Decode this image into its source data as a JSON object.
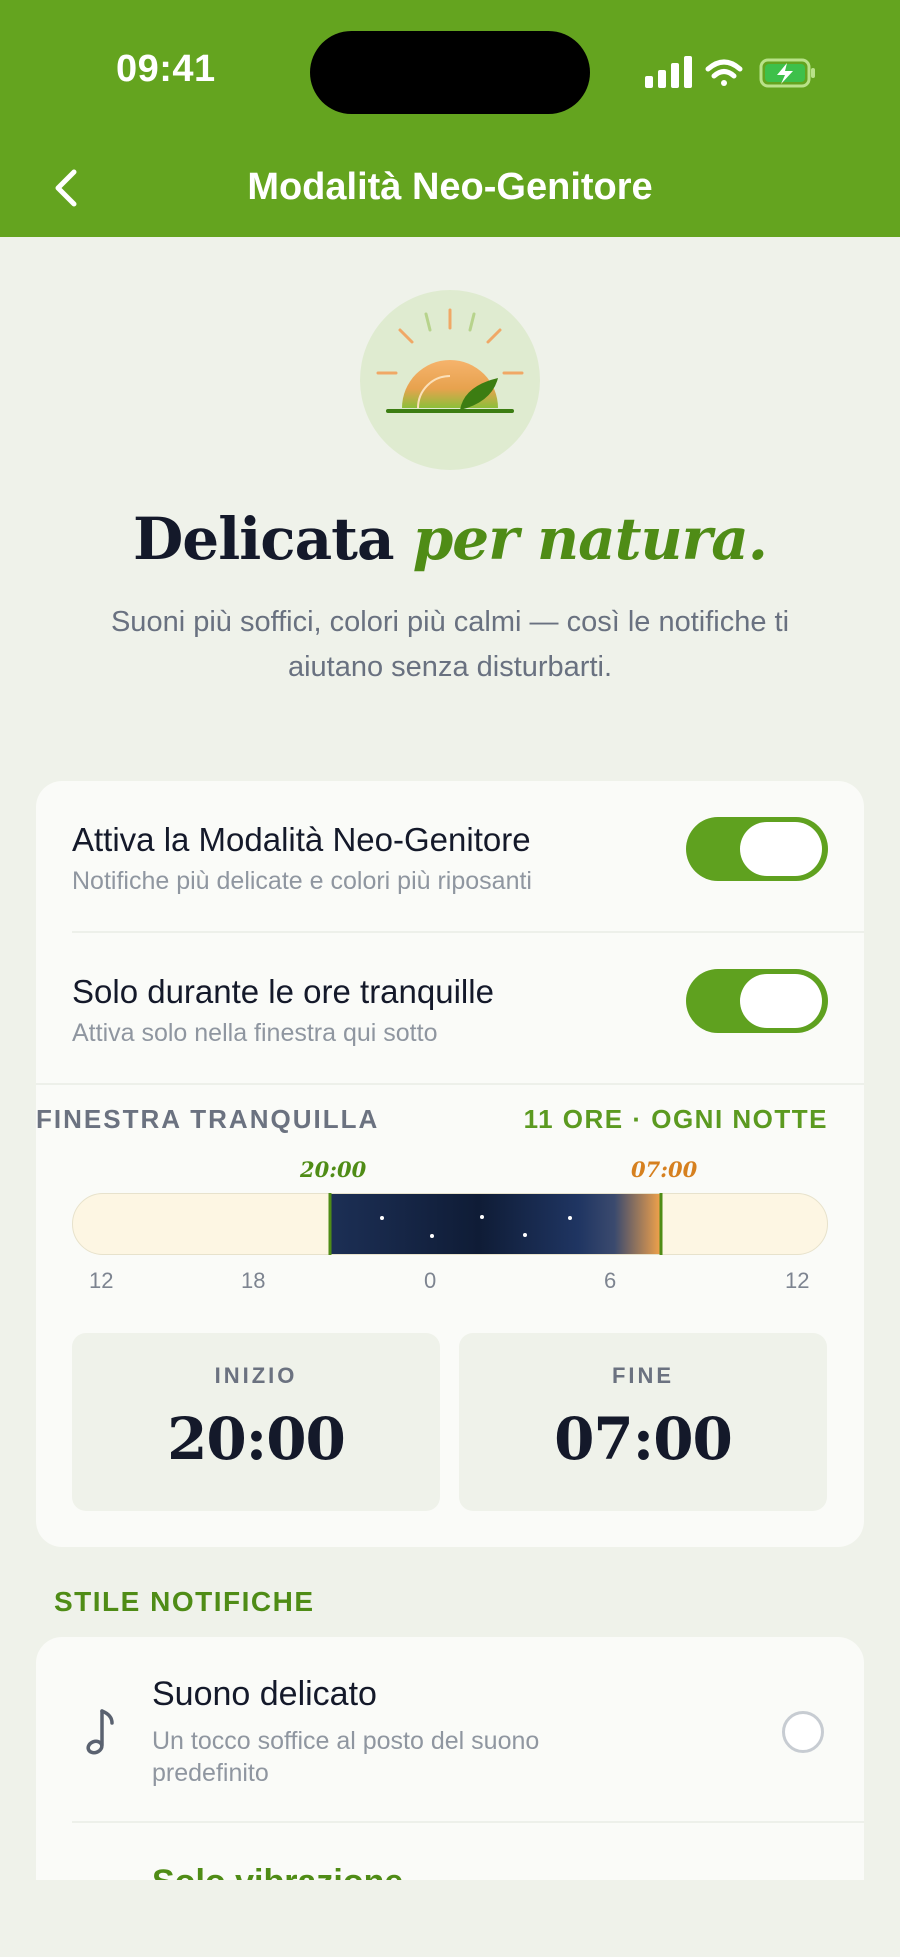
{
  "status_bar": {
    "time": "09:41"
  },
  "header": {
    "title": "Modalità Neo-Genitore"
  },
  "hero": {
    "title_main": "Delicata",
    "title_accent": "per natura.",
    "subtitle": "Suoni più soffici, colori più calmi — così le notifiche ti aiutano senza disturbarti."
  },
  "settings": {
    "mode": {
      "title": "Attiva la Modalità Neo-Genitore",
      "subtitle": "Notifiche più delicate e colori più riposanti",
      "enabled": true
    },
    "quiet_only": {
      "title": "Solo durante le ore tranquille",
      "subtitle": "Attiva solo nella finestra qui sotto",
      "enabled": true
    }
  },
  "quiet_window": {
    "label": "FINESTRA TRANQUILLA",
    "summary": "11 ORE · OGNI NOTTE",
    "start_marker": "20:00",
    "end_marker": "07:00",
    "axis_ticks": [
      "12",
      "18",
      "0",
      "6",
      "12"
    ],
    "start": {
      "label": "INIZIO",
      "value": "20:00"
    },
    "end": {
      "label": "FINE",
      "value": "07:00"
    }
  },
  "notification_style": {
    "section_title": "STILE NOTIFICHE",
    "options": [
      {
        "title": "Suono delicato",
        "subtitle": "Un tocco soffice al posto del suono predefinito",
        "selected": false,
        "icon": "music-note-icon"
      },
      {
        "title": "Solo vibrazione",
        "icon": "phone-vibrate-icon"
      }
    ]
  },
  "colors": {
    "brand_green": "#64a41f",
    "accent_orange": "#d6801f",
    "night_blue": "#1c2f55"
  }
}
